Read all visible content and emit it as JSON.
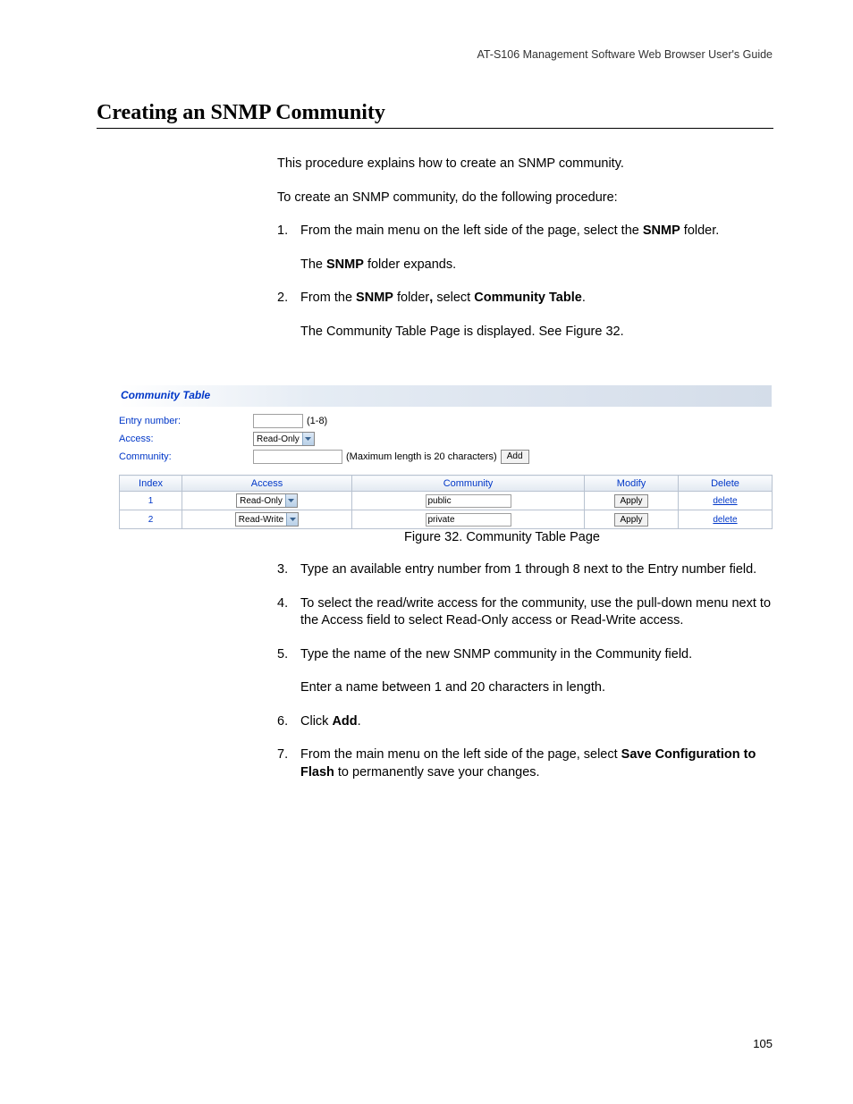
{
  "header": {
    "guide_title": "AT-S106 Management Software Web Browser User's Guide"
  },
  "heading": "Creating an SNMP Community",
  "intro": {
    "p1": "This procedure explains how to create an SNMP community.",
    "p2": "To create an SNMP community, do the following procedure:"
  },
  "steps": {
    "s1_num": "1.",
    "s1_a": "From the main menu on the left side of the page, select the ",
    "s1_b_bold": "SNMP",
    "s1_c": " folder.",
    "s1_sub_a": "The ",
    "s1_sub_b_bold": "SNMP",
    "s1_sub_c": " folder expands.",
    "s2_num": "2.",
    "s2_a": "From the ",
    "s2_b_bold": "SNMP",
    "s2_c": " folder",
    "s2_d_bold": ",",
    "s2_e": " select ",
    "s2_f_bold": "Community Table",
    "s2_g": ".",
    "s2_sub": "The Community Table Page is displayed. See Figure 32.",
    "s3_num": "3.",
    "s3": "Type an available entry number from 1 through 8 next to the Entry number field.",
    "s4_num": "4.",
    "s4": "To select the read/write access for the community, use the pull-down menu next to the Access field to select Read-Only access or Read-Write access.",
    "s5_num": "5.",
    "s5": "Type the name of the new SNMP community in the Community field.",
    "s5_sub": "Enter a name between 1 and 20 characters in length.",
    "s6_num": "6.",
    "s6_a": "Click ",
    "s6_b_bold": "Add",
    "s6_c": ".",
    "s7_num": "7.",
    "s7_a": "From the main menu on the left side of the page, select ",
    "s7_b_bold": "Save Configuration to Flash",
    "s7_c": " to permanently save your changes."
  },
  "figure_caption": "Figure 32. Community Table Page",
  "app": {
    "title": "Community Table",
    "labels": {
      "entry_number": "Entry number:",
      "access": "Access:",
      "community": "Community:"
    },
    "hints": {
      "entry_range": "(1-8)",
      "maxlen": "(Maximum length is 20 characters)"
    },
    "buttons": {
      "add": "Add",
      "apply": "Apply"
    },
    "selects": {
      "readonly": "Read-Only",
      "readwrite": "Read-Write"
    },
    "table": {
      "headers": {
        "index": "Index",
        "access": "Access",
        "community": "Community",
        "modify": "Modify",
        "delete": "Delete"
      },
      "rows": [
        {
          "index": "1",
          "access": "Read-Only",
          "community": "public",
          "delete": "delete"
        },
        {
          "index": "2",
          "access": "Read-Write",
          "community": "private",
          "delete": "delete"
        }
      ]
    }
  },
  "page_number": "105"
}
